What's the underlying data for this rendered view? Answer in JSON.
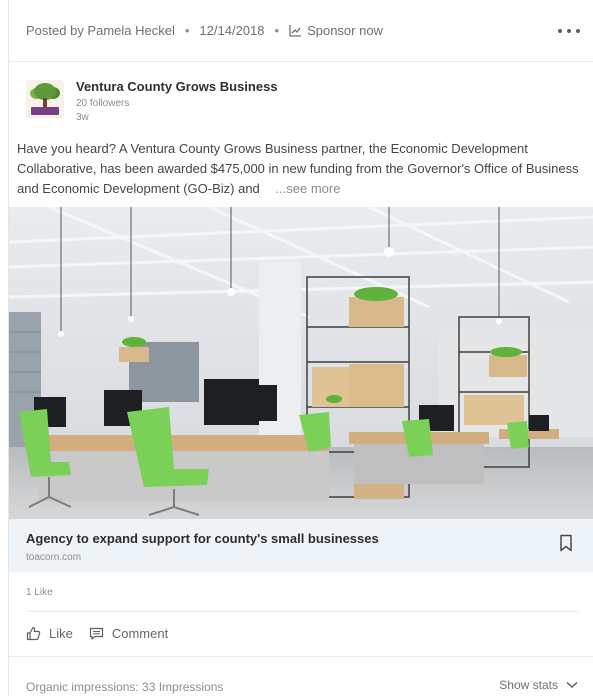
{
  "post_meta": {
    "posted_by": "Posted by Pamela Heckel",
    "date": "12/14/2018",
    "sponsor_label": "Sponsor now",
    "separator": "•"
  },
  "author": {
    "name": "Ventura County Grows Business",
    "followers": "20 followers",
    "age": "3w"
  },
  "post": {
    "text": "Have you heard? A Ventura County Grows Business partner, the Economic Development Collaborative, has been awarded $475,000 in new funding from the Governor's Office of Business and Economic Development (GO-Biz) and",
    "see_more": "...see more"
  },
  "link": {
    "title": "Agency to expand support for county's small businesses",
    "domain": "toacorn.com"
  },
  "social": {
    "likes_count": "1 Like",
    "like_label": "Like",
    "comment_label": "Comment"
  },
  "footer": {
    "impressions": "Organic impressions: 33 Impressions",
    "show_stats": "Show stats"
  },
  "icons": {
    "more": "more-horizontal-icon",
    "sponsor": "chart-trend-icon",
    "bookmark": "bookmark-icon",
    "like": "thumbs-up-icon",
    "comment": "comment-icon",
    "chevron": "chevron-down-icon"
  },
  "colors": {
    "link_bg": "#eef3f8",
    "text": "#454545",
    "muted": "#8c8c8c"
  }
}
